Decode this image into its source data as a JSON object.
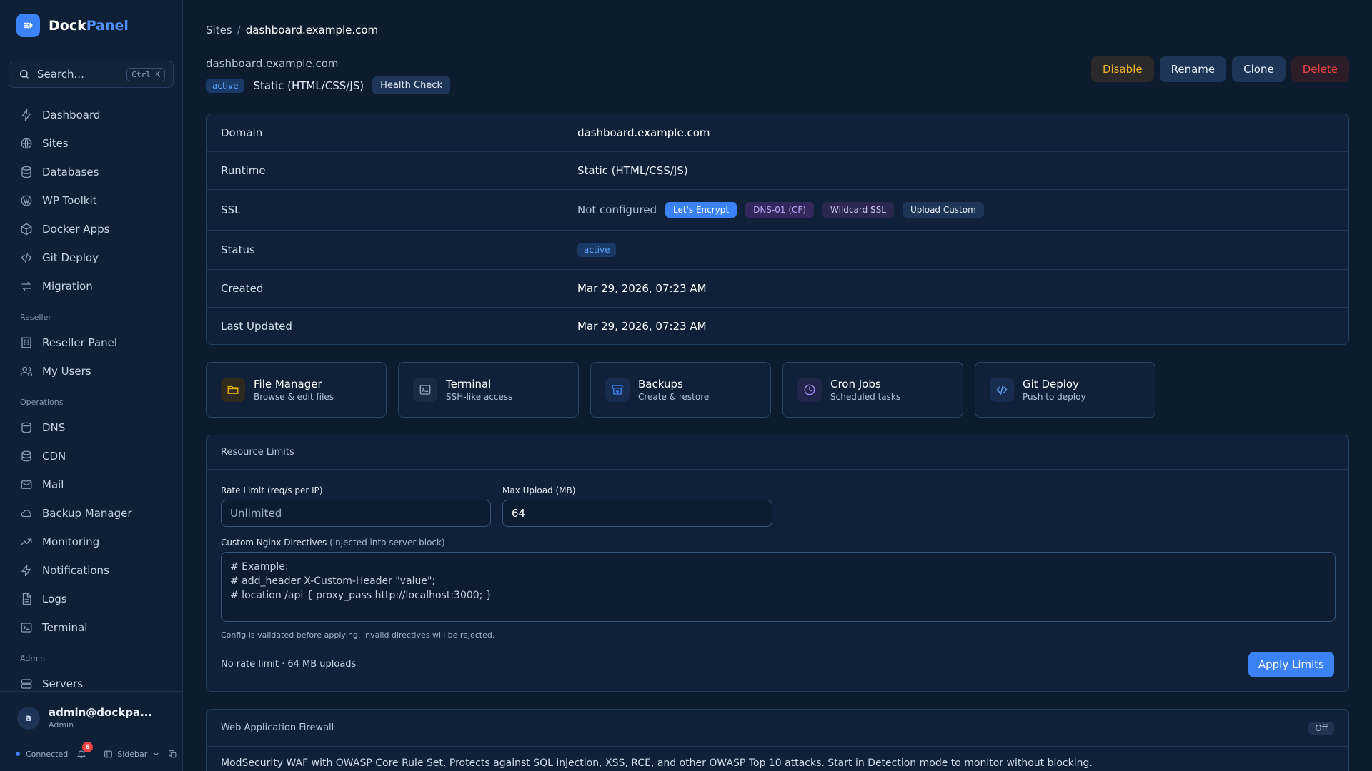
{
  "brand": {
    "name_a": "Dock",
    "name_b": "Panel"
  },
  "search": {
    "placeholder": "Search...",
    "shortcut": "Ctrl K"
  },
  "nav": {
    "main": [
      {
        "label": "Dashboard",
        "icon": "bolt-icon"
      },
      {
        "label": "Sites",
        "icon": "globe-icon"
      },
      {
        "label": "Databases",
        "icon": "database-icon"
      },
      {
        "label": "WP Toolkit",
        "icon": "wordpress-icon"
      },
      {
        "label": "Docker Apps",
        "icon": "box-icon"
      },
      {
        "label": "Git Deploy",
        "icon": "code-icon"
      },
      {
        "label": "Migration",
        "icon": "arrows-icon"
      }
    ],
    "reseller_title": "Reseller",
    "reseller": [
      {
        "label": "Reseller Panel",
        "icon": "building-icon"
      },
      {
        "label": "My Users",
        "icon": "users-icon"
      }
    ],
    "operations_title": "Operations",
    "operations": [
      {
        "label": "DNS",
        "icon": "dns-icon"
      },
      {
        "label": "CDN",
        "icon": "cdn-icon"
      },
      {
        "label": "Mail",
        "icon": "mail-icon"
      },
      {
        "label": "Backup Manager",
        "icon": "cloud-icon"
      },
      {
        "label": "Monitoring",
        "icon": "chart-line-icon"
      },
      {
        "label": "Notifications",
        "icon": "bolt-icon"
      },
      {
        "label": "Logs",
        "icon": "file-icon"
      },
      {
        "label": "Terminal",
        "icon": "terminal-icon"
      }
    ],
    "admin_title": "Admin",
    "admin": [
      {
        "label": "Servers",
        "icon": "server-icon"
      }
    ]
  },
  "user": {
    "initial": "a",
    "name": "admin@dockpa...",
    "role": "Admin"
  },
  "footer": {
    "status": "Connected",
    "notifications": "6",
    "sidebar_label": "Sidebar"
  },
  "breadcrumb": {
    "root": "Sites",
    "current": "dashboard.example.com"
  },
  "site": {
    "domain": "dashboard.example.com",
    "status": "active",
    "runtime": "Static (HTML/CSS/JS)",
    "health_label": "Health Check"
  },
  "actions": {
    "disable": "Disable",
    "rename": "Rename",
    "clone": "Clone",
    "delete": "Delete"
  },
  "info": {
    "domain_label": "Domain",
    "domain": "dashboard.example.com",
    "runtime_label": "Runtime",
    "runtime": "Static (HTML/CSS/JS)",
    "ssl_label": "SSL",
    "ssl_state": "Not configured",
    "ssl_options": [
      "Let's Encrypt",
      "DNS-01 (CF)",
      "Wildcard SSL",
      "Upload Custom"
    ],
    "status_label": "Status",
    "status": "active",
    "created_label": "Created",
    "created": "Mar 29, 2026, 07:23 AM",
    "updated_label": "Last Updated",
    "updated": "Mar 29, 2026, 07:23 AM"
  },
  "tools": [
    {
      "title": "File Manager",
      "desc": "Browse & edit files",
      "icon": "folder-icon",
      "color": "#eab308"
    },
    {
      "title": "Terminal",
      "desc": "SSH-like access",
      "icon": "terminal-icon",
      "color": "#94a3b8"
    },
    {
      "title": "Backups",
      "desc": "Create & restore",
      "icon": "archive-icon",
      "color": "#3b82f6"
    },
    {
      "title": "Cron Jobs",
      "desc": "Scheduled tasks",
      "icon": "clock-icon",
      "color": "#a78bfa"
    },
    {
      "title": "Git Deploy",
      "desc": "Push to deploy",
      "icon": "code-icon",
      "color": "#60a5fa"
    }
  ],
  "limits": {
    "title": "Resource Limits",
    "rate_label": "Rate Limit (req/s per IP)",
    "rate_placeholder": "Unlimited",
    "upload_label": "Max Upload (MB)",
    "upload_value": "64",
    "nginx_label": "Custom Nginx Directives",
    "nginx_hint": "(injected into server block)",
    "nginx_lines": [
      "# Example:",
      "# add_header X-Custom-Header \"value\";",
      "# location /api { proxy_pass http://localhost:3000; }"
    ],
    "validation_hint": "Config is validated before applying. Invalid directives will be rejected.",
    "summary": "No rate limit · 64 MB uploads",
    "apply_label": "Apply Limits"
  },
  "waf": {
    "title": "Web Application Firewall",
    "state": "Off",
    "description": "ModSecurity WAF with OWASP Core Rule Set. Protects against SQL injection, XSS, RCE, and other OWASP Top 10 attacks. Start in Detection mode to monitor without blocking."
  },
  "colors": {
    "accent": "#3b82f6",
    "danger": "#ef4444",
    "warning": "#f0b429",
    "background": "#0d1b2e"
  }
}
